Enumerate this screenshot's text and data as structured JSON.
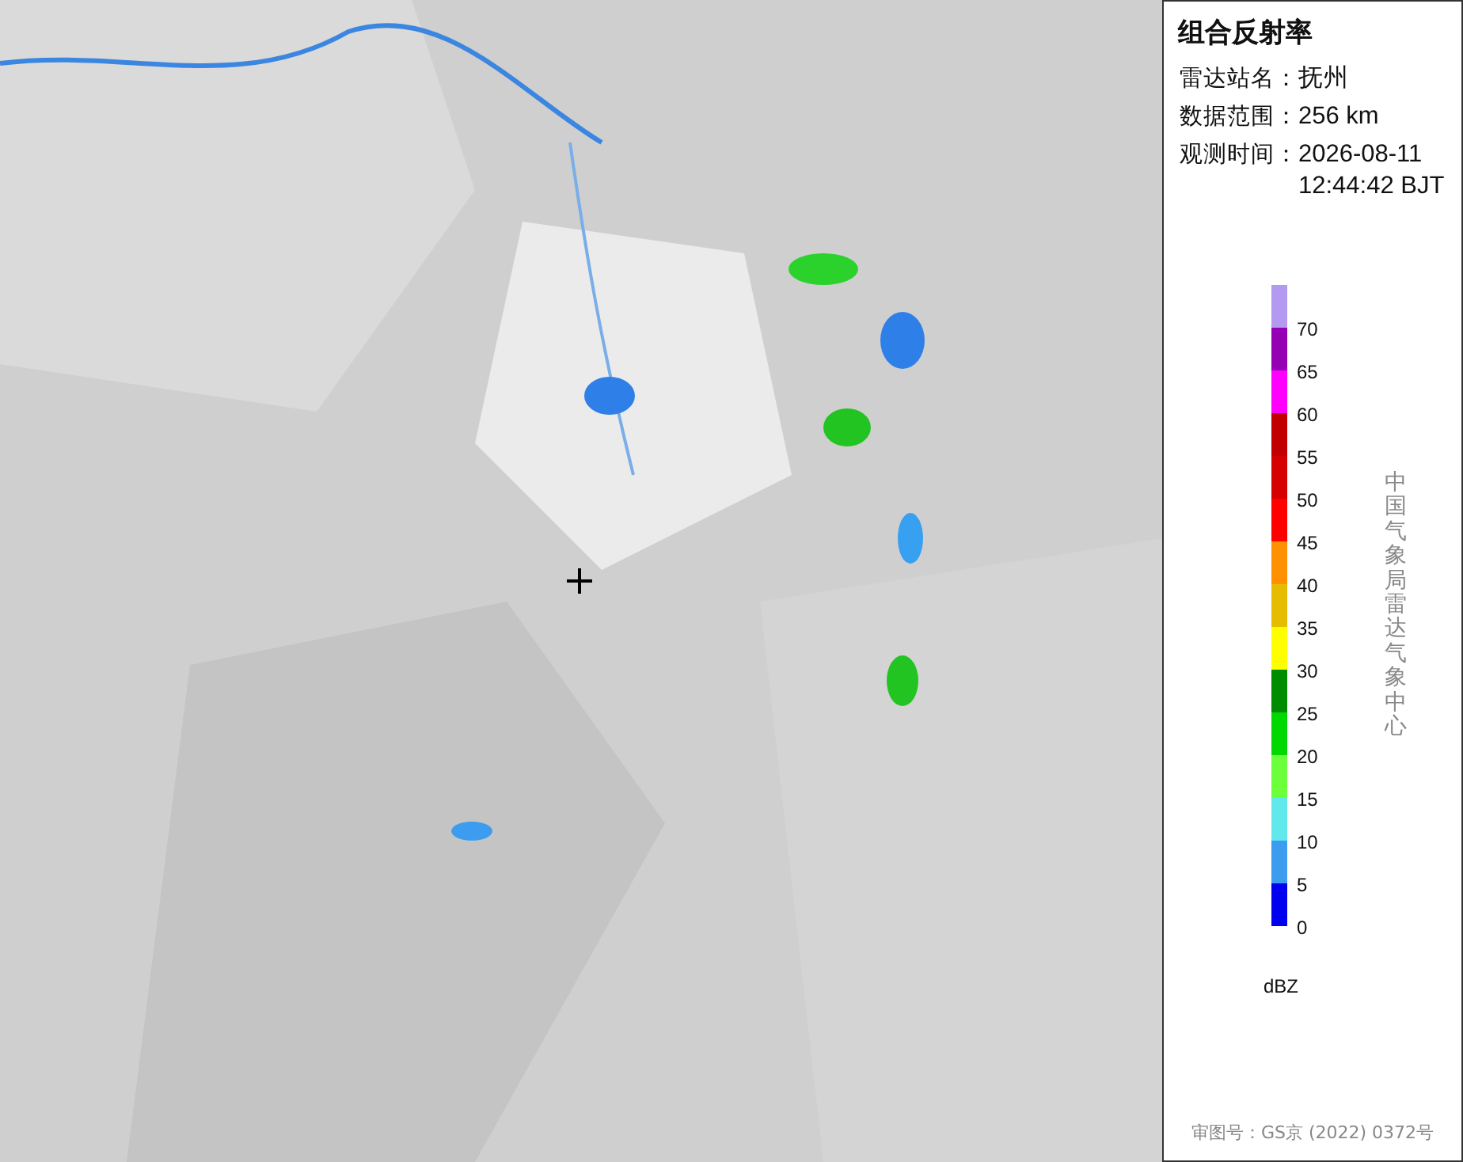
{
  "panel": {
    "title": "组合反射率",
    "fields": [
      {
        "label": "雷达站名：",
        "value": "抚州"
      },
      {
        "label": "数据范围：",
        "value": "256 km"
      },
      {
        "label": "观测时间：",
        "value": "2026-08-11 12:44:42 BJT"
      }
    ],
    "legend": [
      {
        "label": "70",
        "color": "#b39af0"
      },
      {
        "label": "65",
        "color": "#9600b4"
      },
      {
        "label": "60",
        "color": "#ff00ff"
      },
      {
        "label": "55",
        "color": "#c00000"
      },
      {
        "label": "50",
        "color": "#d60000"
      },
      {
        "label": "45",
        "color": "#ff0000"
      },
      {
        "label": "40",
        "color": "#ff9000"
      },
      {
        "label": "35",
        "color": "#e6bc00"
      },
      {
        "label": "30",
        "color": "#ffff00"
      },
      {
        "label": "25",
        "color": "#008c00"
      },
      {
        "label": "20",
        "color": "#00d800"
      },
      {
        "label": "15",
        "color": "#6cff3c"
      },
      {
        "label": "10",
        "color": "#60e8ec"
      },
      {
        "label": "5",
        "color": "#3c9cf0"
      },
      {
        "label": "0",
        "color": "#0000f0"
      }
    ],
    "unit": "dBZ",
    "agency": "中国气象局雷达气象中心",
    "approval": "审图号：GS京 (2022) 0372号"
  }
}
